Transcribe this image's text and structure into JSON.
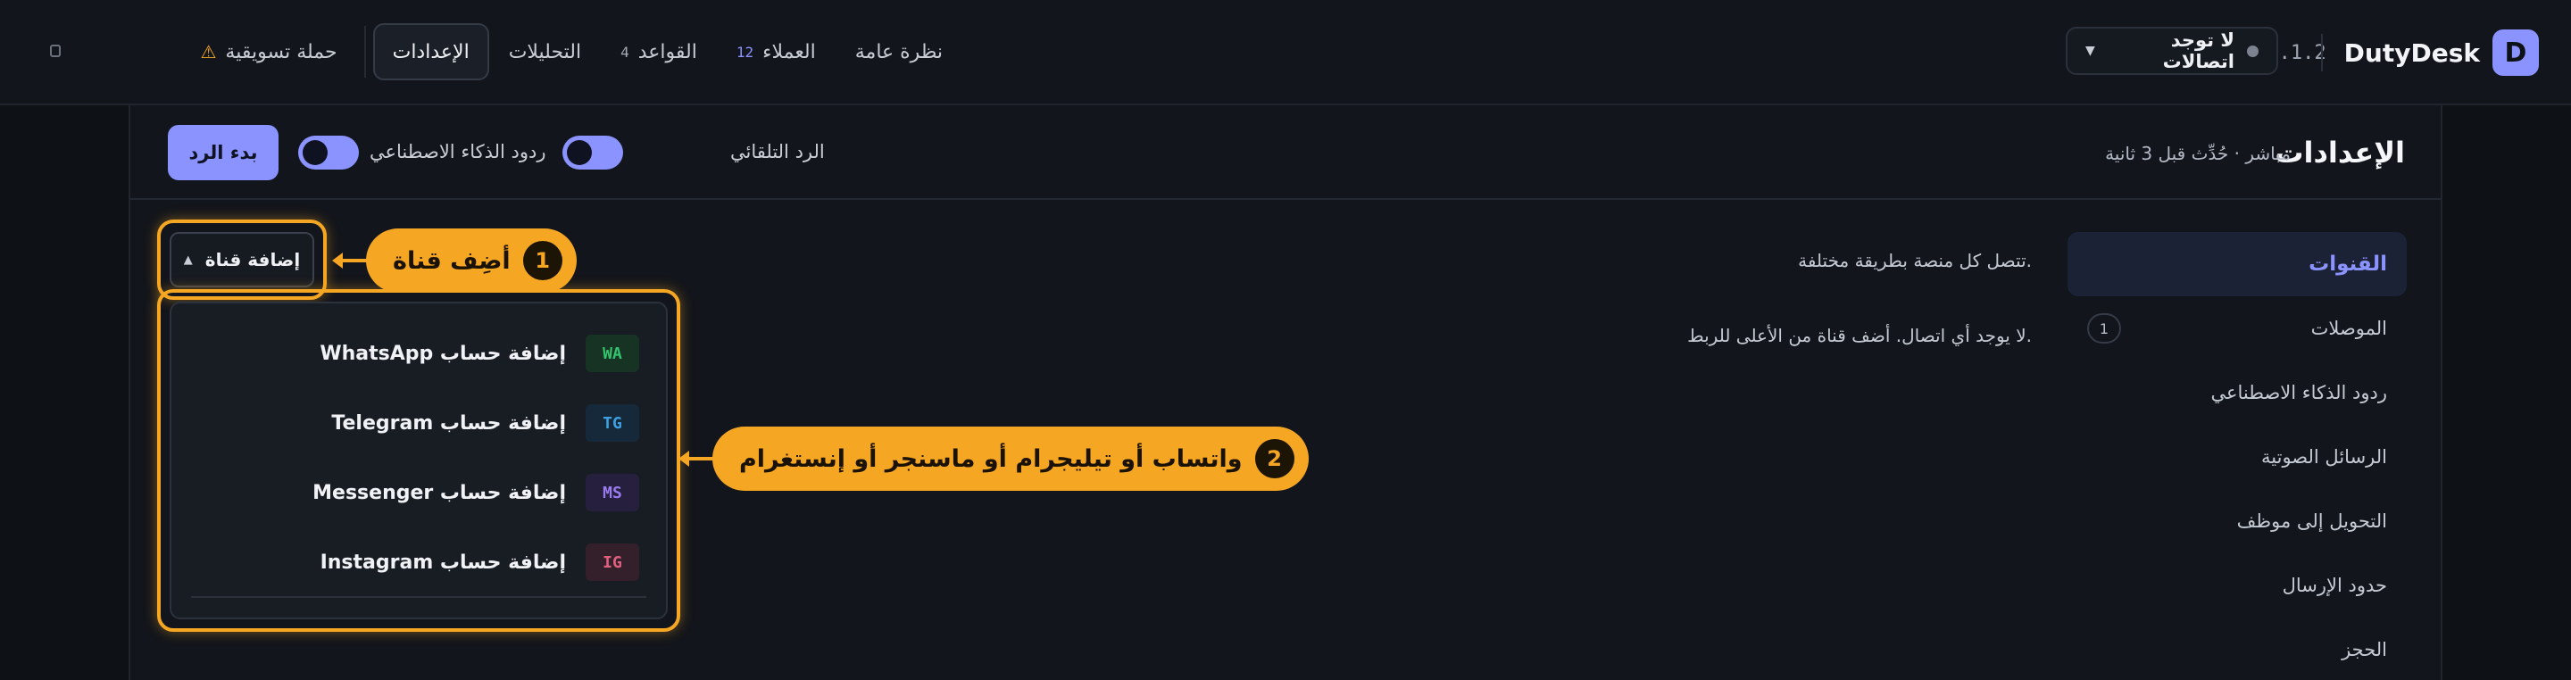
{
  "topnav": {
    "brand_name": "DutyDesk",
    "logo_letter": "D",
    "version": "0.1.2",
    "connection": {
      "label": "لا توجد اتصالات"
    },
    "items": [
      {
        "label": "نظرة عامة"
      },
      {
        "label": "العملاء",
        "count": "12"
      },
      {
        "label": "القواعد",
        "count": "4"
      },
      {
        "label": "التحليلات"
      },
      {
        "label": "الإعدادات",
        "active": true
      },
      {
        "label": "حملة تسويقية",
        "icon": "warning-icon"
      }
    ]
  },
  "header": {
    "title": "الإعدادات",
    "subtitle": "مباشر · حُدِّث قبل 3 ثانية",
    "auto_reply_label": "الرد التلقائي",
    "ai_reply_label": "ردود الذكاء الاصطناعي",
    "start_button": "بدء الرد"
  },
  "sidebar": {
    "items": [
      {
        "label": "القنوات",
        "active": true
      },
      {
        "label": "الموصلات",
        "badge": "1"
      },
      {
        "label": "ردود الذكاء الاصطناعي"
      },
      {
        "label": "الرسائل الصوتية"
      },
      {
        "label": "التحويل إلى موظف"
      },
      {
        "label": "حدود الإرسال"
      },
      {
        "label": "الحجز"
      }
    ]
  },
  "content": {
    "description": "تتصل كل منصة بطريقة مختلفة.",
    "empty_state": "لا يوجد أي اتصال. أضف قناة من الأعلى للربط.",
    "add_channel_button": "إضافة قناة"
  },
  "dropdown": {
    "items": [
      {
        "tag": "WA",
        "label": "إضافة حساب WhatsApp"
      },
      {
        "tag": "TG",
        "label": "إضافة حساب Telegram"
      },
      {
        "tag": "MS",
        "label": "إضافة حساب Messenger"
      },
      {
        "tag": "IG",
        "label": "إضافة حساب Instagram"
      }
    ]
  },
  "callouts": [
    {
      "number": "1",
      "text": "أضِف قناة"
    },
    {
      "number": "2",
      "text": "واتساب أو تيليجرام أو ماسنجر أو إنستغرام"
    }
  ],
  "colors": {
    "accent": "#8a93ff",
    "callout": "#f5a623",
    "background": "#0e1116"
  }
}
